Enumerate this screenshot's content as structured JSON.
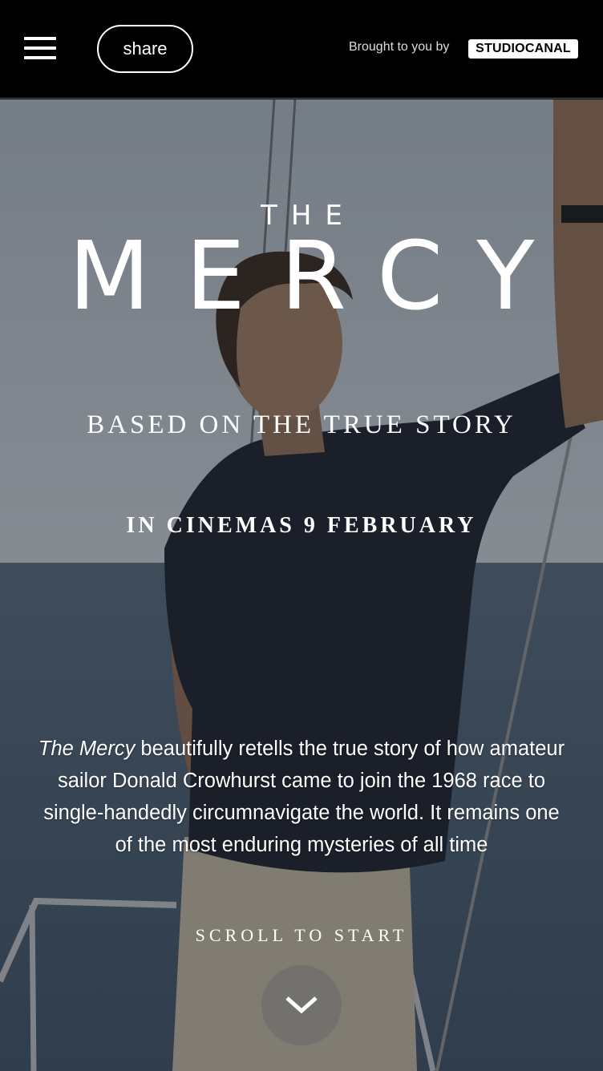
{
  "header": {
    "menu_icon": "hamburger-menu-icon",
    "share_label": "share",
    "brought_by": "Brought to you by",
    "brand": "STUDIOCANAL"
  },
  "hero": {
    "title_prefix": "THE",
    "title": "MERCY",
    "subtitle": "BASED ON THE TRUE STORY",
    "release": "IN CINEMAS 9 FEBRUARY",
    "description_title": "The Mercy",
    "description_body": " beautifully retells the true story of how amateur sailor Donald Crowhurst came to join the 1968 race to single-handedly circumnavigate the world. It remains one of the most enduring mysteries of all time",
    "scroll_label": "SCROLL TO START",
    "scroll_icon": "chevron-down-icon"
  },
  "colors": {
    "header_bg": "#000000",
    "text": "#ffffff",
    "sky": "#aeb8c2",
    "sea": "#4d6378"
  }
}
